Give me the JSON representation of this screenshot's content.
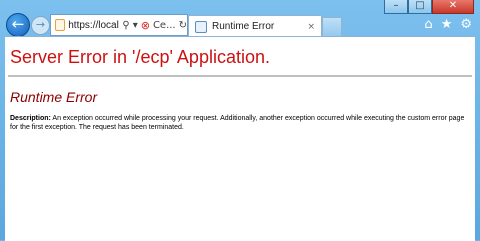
{
  "window": {
    "controls": [
      "–",
      "□",
      "✕"
    ]
  },
  "nav": {
    "back_glyph": "←",
    "forward_glyph": "→"
  },
  "address": {
    "url": "https://local...",
    "search_glyph": "⚲",
    "dropdown_glyph": "▾",
    "error_glyph": "⊗",
    "tab_label_short": "Ce...",
    "refresh_glyph": "↻"
  },
  "tab": {
    "title": "Runtime Error",
    "close_glyph": "×"
  },
  "toolbar": {
    "home_glyph": "⌂",
    "favorites_glyph": "★",
    "settings_glyph": "⚙"
  },
  "page": {
    "title": "Server Error in '/ecp' Application.",
    "subtitle": "Runtime Error",
    "description_label": "Description:",
    "description_text": " An exception occurred while processing your request. Additionally, another exception occurred while executing the custom error page for the first exception. The request has been terminated."
  },
  "colors": {
    "title": "#cc1111",
    "subtitle": "#8a0000",
    "chrome": "#6fb5e6"
  }
}
